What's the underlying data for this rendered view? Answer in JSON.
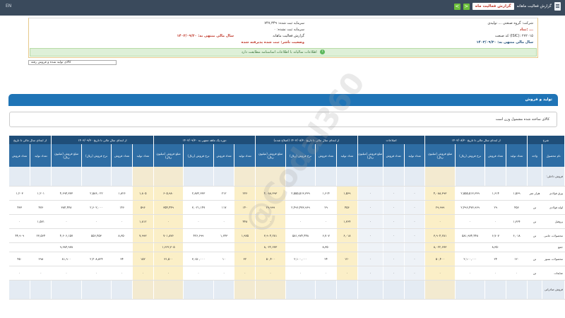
{
  "topbar": {
    "title": "گزارش فعالیت ماهانه",
    "badge": "گزارش فعالیت ماه",
    "prev": "<",
    "next": ">",
    "left_text": "EN"
  },
  "info": {
    "row1": "شرکت: گروه صنعتی ... تولیدی",
    "row1b": "سرمایه ثبت شده: ۷۴۷,۳۴۹",
    "row2": "نماد: ...",
    "row2b": "سرمایه ثبت نشده: ۰",
    "row3": "کد صنعت (ISIC): ۲۷۲۰۱۵",
    "row3b": "گزارش فعالیت ماهانه",
    "row3c": "سال مالی منتهی به: ۱۴۰۲/۰۹/۳۰",
    "row4": "سال مالی منتهی به: ۱۴۰۳/۰۹/۳۰",
    "row4b": "وضعیت ناشر: ثبت شده پذیرفته شده",
    "notice": "اطلاعات سالیانه با اطلاعات اساسنامه مطابقت دارد"
  },
  "select_value": "کالای تولید شده و فروش رفته",
  "section_title": "تولید و فروش",
  "comment": "کالای ساخته شده مشمول وزن است",
  "table": {
    "group_headers": [
      "شرح",
      "از ابتدای سال مالی تا تاریخ ۱۴۰۳/۰۸/۳۰",
      "اصلاحات",
      "از ابتدای سال مالی تا تاریخ ۱۴۰۳/۰۸/۳۰ (اصلاح شده)",
      "دوره یک ماهه منتهی به ۱۴۰۳/۰۹/۳۰",
      "از ابتدای سال مالی تا تاریخ ۱۴۰۳/۰۹/۳۰",
      "از ابتدای سال مالی تا تاریخ"
    ],
    "col_headers": [
      "نام محصول",
      "واحد",
      "تعداد تولید",
      "تعداد فروش",
      "نرخ فروش (ریال)",
      "مبلغ فروش (میلیون ریال)",
      "تعداد تولید",
      "تعداد فروش",
      "مبلغ فروش (میلیون ریال)",
      "تعداد تولید",
      "تعداد فروش",
      "نرخ فروش (ریال)",
      "مبلغ فروش (میلیون ریال)",
      "تعداد تولید",
      "تعداد فروش",
      "نرخ فروش (ریال)",
      "مبلغ فروش (میلیون ریال)",
      "تعداد تولید",
      "تعداد فروش",
      "نرخ فروش (ریال)",
      "مبلغ فروش (میلیون ریال)",
      "تعداد تولید",
      "تعداد فروش"
    ],
    "section_label": "فروش داخلی:",
    "rows": [
      {
        "label": "ورق فولادی",
        "unit": "هزار متر",
        "cells": [
          "۱,۵۶۹",
          "۱,۶۱۴",
          "۲,۵۵۵,۵۱۳,۳۳۹",
          "۴,۰۸۸,۳۹۳",
          "۰",
          "۰",
          "۰",
          "۱,۵۶۹",
          "۱,۶۱۴",
          "۲,۵۵۵,۵۱۳,۳۳۹",
          "۴,۰۸۸,۳۹۳",
          "۲۳۶",
          "۲۱۲",
          "۲,۸۷۲,۳۳۳",
          "۶۰۵,۹۸۰",
          "۱,۸۰۵",
          "۱,۸۲۶",
          "۲,۵۸۶,۰۲۲",
          "۴,۶۹۴,۳۷۳",
          "۱,۲۰۱",
          "۱,۲۰۳"
        ]
      },
      {
        "label": "لوله فولادی",
        "unit": "تن",
        "cells": [
          "۴۵۶",
          "۲۹",
          "۲,۴۹۶,۴۷۳,۹۶۹",
          "۲۹,۹۹۹",
          "۰",
          "۰",
          "۰",
          "۴۵۶",
          "۲۹",
          "۲,۴۹۶,۴۷۳,۹۶۹",
          "۲۹,۹۹۹",
          "۱۴۰",
          "۱۱۷",
          "۳,۰۲۱,۱۴۷",
          "۳۵۴,۴۴۹",
          "۵۹۶",
          "۱۴۶",
          "۲,۶۰۲,۰۰۰",
          "۳۸۴,۴۴۸",
          "۴۷۶",
          "۴۳۳"
        ]
      },
      {
        "label": "پروفیل",
        "unit": "تن",
        "cells": [
          "۱,۳۶۴",
          "۰",
          "۰",
          "۰",
          "۰",
          "۰",
          "۰",
          "۱,۳۶۴",
          "۰",
          "۰",
          "۰",
          "۴۴۸",
          "۰",
          "۰",
          "۰",
          "۱,۸۱۲",
          "۰",
          "۰",
          "۰",
          "۱,۵۷۱",
          "۰"
        ]
      },
      {
        "label": "محصولات جانبی",
        "unit": "تن",
        "cells": [
          "۶,۰۱۸",
          "۶,۷۰۷",
          "۵۸۱,۹۷۴,۴۴۸",
          "۳,۹۰۴,۲۸۱",
          "۰",
          "۰",
          "۰",
          "۶,۰۱۸",
          "۶,۷۰۷",
          "۵۸۱,۹۷۴,۴۴۸",
          "۳,۹۰۴,۲۸۱",
          "۱,۹۷۵",
          "۱,۶۴۳",
          "۴۲۶,۶۹۹",
          "۷۰۱,۸۷۶",
          "۷,۹۹۳",
          "۸,۳۵۰",
          "۵۵۶,۴۵۳",
          "۴,۶۰۶,۱۵۷",
          "۲۳,۵۶۴",
          "۴۴,۹۰۹"
        ]
      }
    ],
    "total": {
      "label": "جمع",
      "cells": [
        "",
        "۸,۳۵۰",
        "",
        "۸,۰۲۲,۶۷۳",
        "",
        "",
        "",
        "",
        "۸,۳۵۰",
        "",
        "۸,۰۲۲,۶۷۳",
        "",
        "",
        "",
        "۱,۶۶۲,۳۰۵",
        "",
        "",
        "",
        "۹,۶۸۴,۹۷۸",
        "",
        ""
      ]
    },
    "row6": {
      "label": "محصولات نسوز",
      "unit": "تن",
      "cells": [
        "۱۲۰",
        "۲۴",
        "۲,۱۰۰,۰۰۰",
        "۵۰,۴۰۰",
        "۰",
        "۰",
        "۰",
        "۱۲۰",
        "۲۴",
        "۲,۱۰۰,۰۰۰",
        "۵۰,۴۰۰",
        "۳۲",
        "۱۰",
        "۳,۱۵۰,۰۰۰",
        "۳۱,۵۰۰",
        "۱۵۲",
        "۳۴",
        "۲,۴۰۸,۸۲۴",
        "۸۱,۹۰۰",
        "۲۹۸",
        "۴۵۰"
      ]
    },
    "row7": {
      "label": "ضایعات",
      "unit": "تن",
      "cells": [
        "۰",
        "۰",
        "۰",
        "۰",
        "۰",
        "۰",
        "۰",
        "۰",
        "۰",
        "۰",
        "۰",
        "۰",
        "۰",
        "۰",
        "۰",
        "۰",
        "۰",
        "۰",
        "۰",
        "۰",
        "۰"
      ]
    },
    "row8": {
      "label": "فروش صادراتی",
      "unit": "",
      "cells": [
        "",
        "",
        "",
        "",
        "",
        "",
        "",
        "",
        "",
        "",
        "",
        "",
        "",
        "",
        "",
        "",
        "",
        "",
        "",
        "",
        ""
      ]
    }
  }
}
